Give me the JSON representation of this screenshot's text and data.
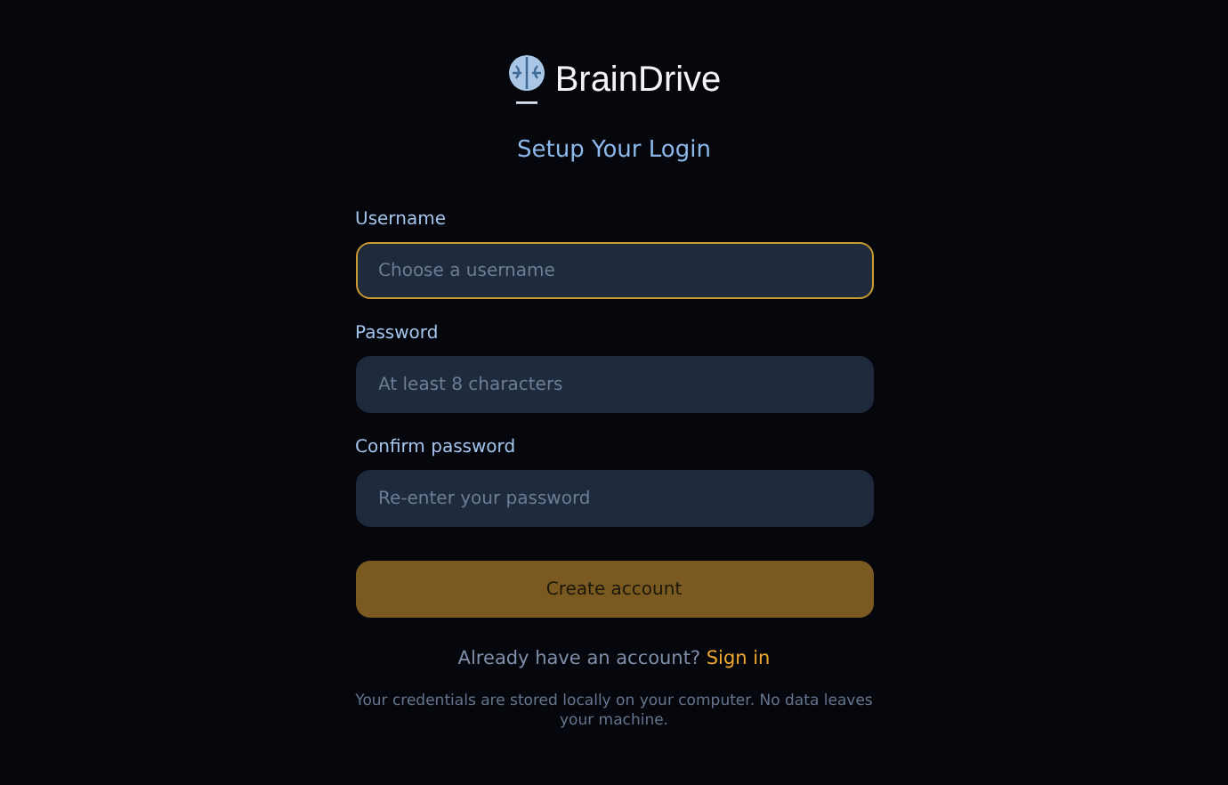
{
  "brand": {
    "name": "BrainDrive"
  },
  "title": "Setup Your Login",
  "fields": [
    {
      "label": "Username",
      "placeholder": "Choose a username",
      "focused": true
    },
    {
      "label": "Password",
      "placeholder": "At least 8 characters",
      "focused": false
    },
    {
      "label": "Confirm password",
      "placeholder": "Re-enter your password",
      "focused": false
    }
  ],
  "submit": "Create account",
  "signin": {
    "prompt": "Already have an account?",
    "link": "Sign in"
  },
  "note": "Your credentials are stored locally on your computer. No data leaves your machine."
}
